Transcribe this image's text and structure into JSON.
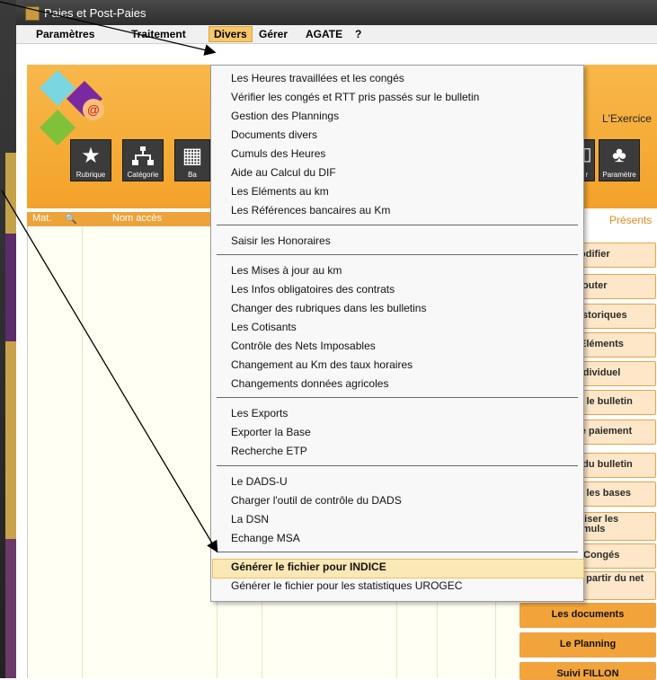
{
  "window": {
    "title": "Paies et Post-Paies"
  },
  "menu": {
    "items": [
      "Paramètres",
      "Traitement",
      "Divers",
      "Gérer",
      "AGATE",
      "?"
    ],
    "active": "Divers"
  },
  "banner": {
    "exercice_label": "L'Exercice"
  },
  "toolbar": {
    "buttons": [
      {
        "label": "Rubrique",
        "icon": "star-icon"
      },
      {
        "label": "Catégorie",
        "icon": "hierarchy-icon"
      },
      {
        "label": "Ba",
        "icon": "grid-icon"
      },
      {
        "label": "r",
        "icon": "document-icon"
      },
      {
        "label": "Paramètre",
        "icon": "tree-icon"
      }
    ]
  },
  "grid": {
    "columns": [
      "Mat.",
      "Nom accès"
    ]
  },
  "right_panel": {
    "presents_label": "Présents",
    "buttons": [
      "odifier",
      "jouter",
      "istoriques",
      "Eléments",
      "individuel",
      "er le bulletin",
      "de paiement",
      "e du bulletin",
      "er les bases",
      "aliser les umuls",
      "Congés",
      "à partir du net",
      "Les documents",
      "Le Planning",
      "Suivi FILLON"
    ]
  },
  "dropdown": {
    "groups": [
      [
        "Les Heures travaillées et les congés",
        "Vérifier les congés et RTT pris passés sur le bulletin",
        "Gestion des Plannings",
        "Documents divers",
        "Cumuls des Heures",
        "Aide au Calcul du DIF",
        "Les Eléments au km",
        "Les Références bancaires au Km"
      ],
      [
        "Saisir les Honoraires"
      ],
      [
        "Les Mises à jour au km",
        "Les Infos obligatoires des contrats",
        "Changer des rubriques dans les bulletins",
        "Les Cotisants",
        "Contrôle des Nets Imposables",
        "Changement au Km des taux horaires",
        "Changements données agricoles"
      ],
      [
        "Les Exports",
        "Exporter la Base",
        "Recherche ETP"
      ],
      [
        "Le DADS-U",
        "Charger l'outil de contrôle du DADS",
        "La DSN",
        "Echange MSA"
      ],
      [
        "Générer le fichier pour INDICE",
        "Générer le fichier pour les statistiques UROGEC"
      ]
    ],
    "highlighted": "Générer le fichier pour INDICE"
  },
  "colors": {
    "accent": "#f3a22a",
    "highlight": "#fbe8b7",
    "menu_active": "#f7c768"
  }
}
